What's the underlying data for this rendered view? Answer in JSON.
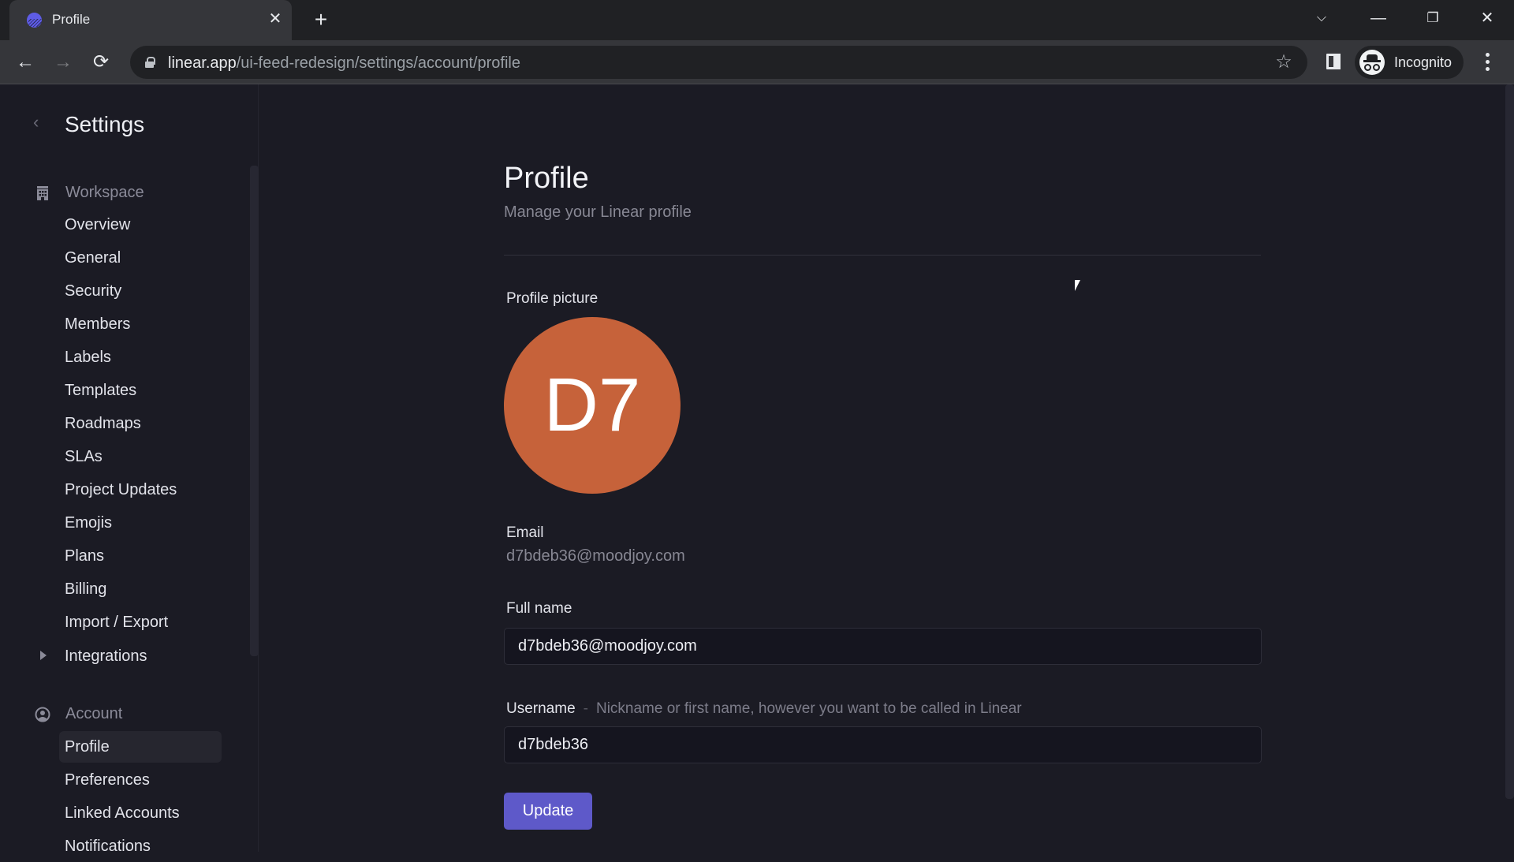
{
  "browser": {
    "tab": {
      "title": "Profile",
      "favicon": "linear-logo-icon"
    },
    "new_tab_label": "+",
    "url_host": "linear.app",
    "url_path": "/ui-feed-redesign/settings/account/profile",
    "profile_label": "Incognito"
  },
  "sidebar": {
    "title": "Settings",
    "sections": [
      {
        "label": "Workspace",
        "icon": "building-icon",
        "items": [
          {
            "label": "Overview"
          },
          {
            "label": "General"
          },
          {
            "label": "Security"
          },
          {
            "label": "Members"
          },
          {
            "label": "Labels"
          },
          {
            "label": "Templates"
          },
          {
            "label": "Roadmaps"
          },
          {
            "label": "SLAs"
          },
          {
            "label": "Project Updates"
          },
          {
            "label": "Emojis"
          },
          {
            "label": "Plans"
          },
          {
            "label": "Billing"
          },
          {
            "label": "Import / Export"
          },
          {
            "label": "Integrations",
            "expandable": true
          }
        ]
      },
      {
        "label": "Account",
        "icon": "user-circle-icon",
        "items": [
          {
            "label": "Profile",
            "active": true
          },
          {
            "label": "Preferences"
          },
          {
            "label": "Linked Accounts"
          },
          {
            "label": "Notifications"
          }
        ]
      }
    ]
  },
  "main": {
    "title": "Profile",
    "subtitle": "Manage your Linear profile",
    "profile_picture": {
      "label": "Profile picture",
      "initials": "D7",
      "color": "#c6623a"
    },
    "email": {
      "label": "Email",
      "value": "d7bdeb36@moodjoy.com"
    },
    "full_name": {
      "label": "Full name",
      "value": "d7bdeb36@moodjoy.com"
    },
    "username": {
      "label": "Username",
      "separator": "-",
      "hint": "Nickname or first name, however you want to be called in Linear",
      "value": "d7bdeb36"
    },
    "update_button": "Update"
  },
  "colors": {
    "accent": "#5e59c9",
    "background": "#1b1b24",
    "avatar": "#c6623a"
  }
}
